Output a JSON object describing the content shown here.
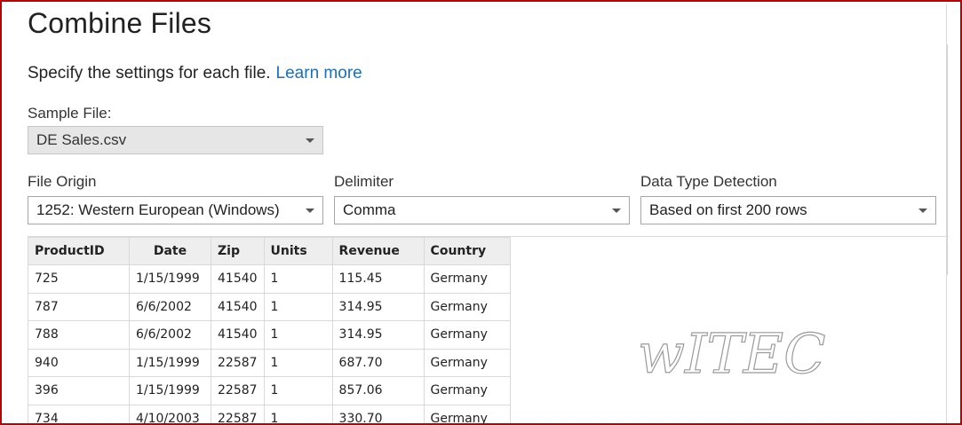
{
  "dialog": {
    "title": "Combine Files",
    "subtitle": "Specify the settings for each file.",
    "learn_more": "Learn more"
  },
  "sample_file": {
    "label": "Sample File:",
    "value": "DE Sales.csv"
  },
  "file_origin": {
    "label": "File Origin",
    "value": "1252: Western European (Windows)"
  },
  "delimiter": {
    "label": "Delimiter",
    "value": "Comma"
  },
  "data_type_detection": {
    "label": "Data Type Detection",
    "value": "Based on first 200 rows"
  },
  "preview": {
    "columns": [
      "ProductID",
      "Date",
      "Zip",
      "Units",
      "Revenue",
      "Country"
    ],
    "rows": [
      [
        "725",
        "1/15/1999",
        "41540",
        "1",
        "115.45",
        "Germany"
      ],
      [
        "787",
        "6/6/2002",
        "41540",
        "1",
        "314.95",
        "Germany"
      ],
      [
        "788",
        "6/6/2002",
        "41540",
        "1",
        "314.95",
        "Germany"
      ],
      [
        "940",
        "1/15/1999",
        "22587",
        "1",
        "687.70",
        "Germany"
      ],
      [
        "396",
        "1/15/1999",
        "22587",
        "1",
        "857.06",
        "Germany"
      ],
      [
        "734",
        "4/10/2003",
        "22587",
        "1",
        "330.70",
        "Germany"
      ]
    ]
  },
  "watermark": {
    "text": "wITEC"
  },
  "colors": {
    "frame_border": "#c00000",
    "link": "#1e6fb8",
    "header_bg": "#eeeeee",
    "disabled_bg": "#e6e6e6"
  }
}
